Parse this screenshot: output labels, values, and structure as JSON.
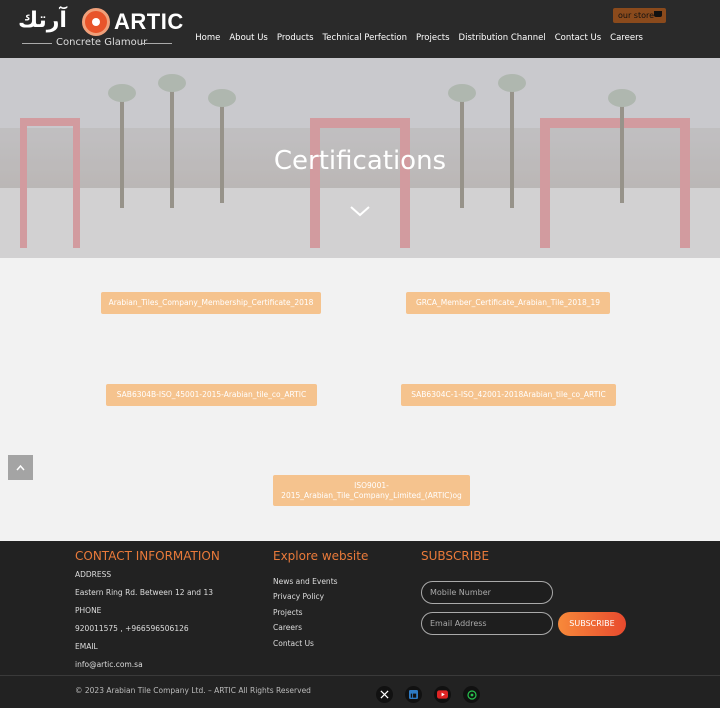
{
  "header": {
    "logo_arabic": "آرتك",
    "logo_word": "ARTIC",
    "logo_tagline": "Concrete Glamour",
    "store_label": "our store",
    "nav": [
      "Home",
      "About Us",
      "Products",
      "Technical Perfection",
      "Projects",
      "Distribution Channel",
      "Contact Us",
      "Careers"
    ]
  },
  "hero": {
    "title": "Certifications"
  },
  "certificates": [
    "Arabian_Tiles_Company_Membership_Certificate_2018",
    "GRCA_Member_Certificate_Arabian_Tile_2018_19",
    "SAB6304B-ISO_45001-2015-Arabian_tile_co_ARTIC",
    "SAB6304C-1-ISO_42001-2018Arabian_tile_co_ARTIC",
    "ISO9001-2015_Arabian_Tile_Company_Limited_(ARTIC)og"
  ],
  "footer": {
    "contact_heading": "CONTACT INFORMATION",
    "address_label": "ADDRESS",
    "address_value": "Eastern Ring Rd. Between 12 and 13",
    "phone_label": "PHONE",
    "phone_value": "920011575 , +966596506126",
    "email_label": "EMAIL",
    "email_value": "info@artic.com.sa",
    "explore_heading": "Explore website",
    "explore_links": [
      "News and Events",
      "Privacy Policy",
      "Projects",
      "Careers",
      "Contact Us"
    ],
    "subscribe_heading": "SUBSCRIBE",
    "mobile_placeholder": "Mobile Number",
    "email_placeholder": "Email Address",
    "subscribe_button": "SUBSCRIBE",
    "copyright": "© 2023 Arabian Tile Company Ltd. – ARTIC All Rights Reserved",
    "social_icons": [
      "x-icon",
      "linkedin-icon",
      "youtube-icon",
      "whatsapp-icon"
    ]
  },
  "colors": {
    "accent": "#ea7a3a",
    "cert_button": "#f5c38e",
    "header_bg": "#2a2a2a",
    "footer_bg": "#222222"
  }
}
